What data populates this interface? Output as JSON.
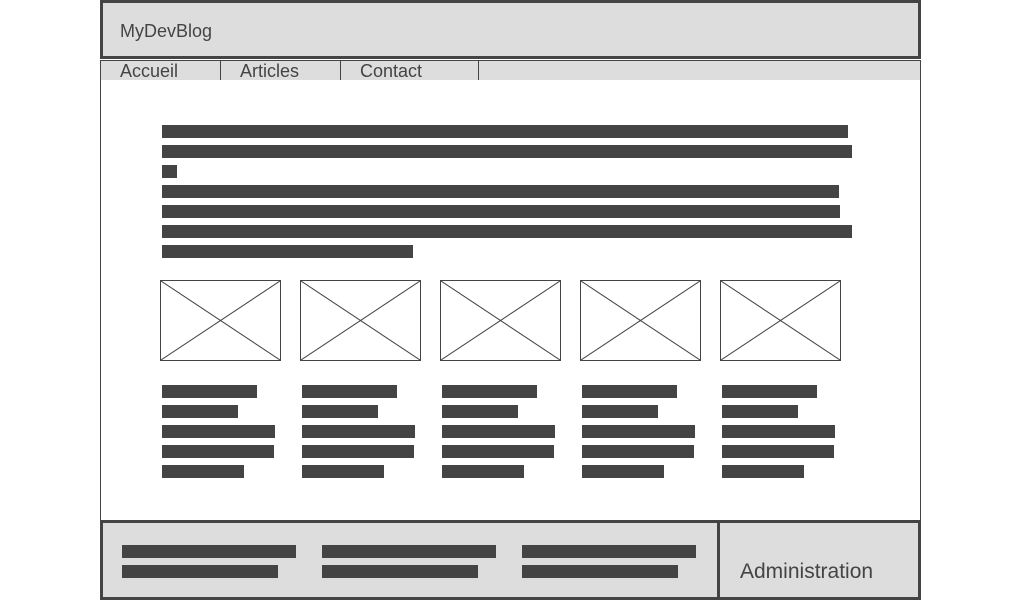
{
  "header": {
    "site_title": "MyDevBlog"
  },
  "nav": {
    "items": [
      "Accueil",
      "Articles",
      "Contact"
    ]
  },
  "main": {
    "intro_placeholder_lines": 7,
    "articles": [
      {
        "thumbnail": "image-placeholder-icon",
        "text_lines": 5
      },
      {
        "thumbnail": "image-placeholder-icon",
        "text_lines": 5
      },
      {
        "thumbnail": "image-placeholder-icon",
        "text_lines": 5
      },
      {
        "thumbnail": "image-placeholder-icon",
        "text_lines": 5
      },
      {
        "thumbnail": "image-placeholder-icon",
        "text_lines": 5
      }
    ]
  },
  "footer": {
    "columns": 3,
    "admin_label": "Administration"
  },
  "colors": {
    "chrome": "#dddddd",
    "ink": "#444444",
    "background": "#ffffff"
  }
}
